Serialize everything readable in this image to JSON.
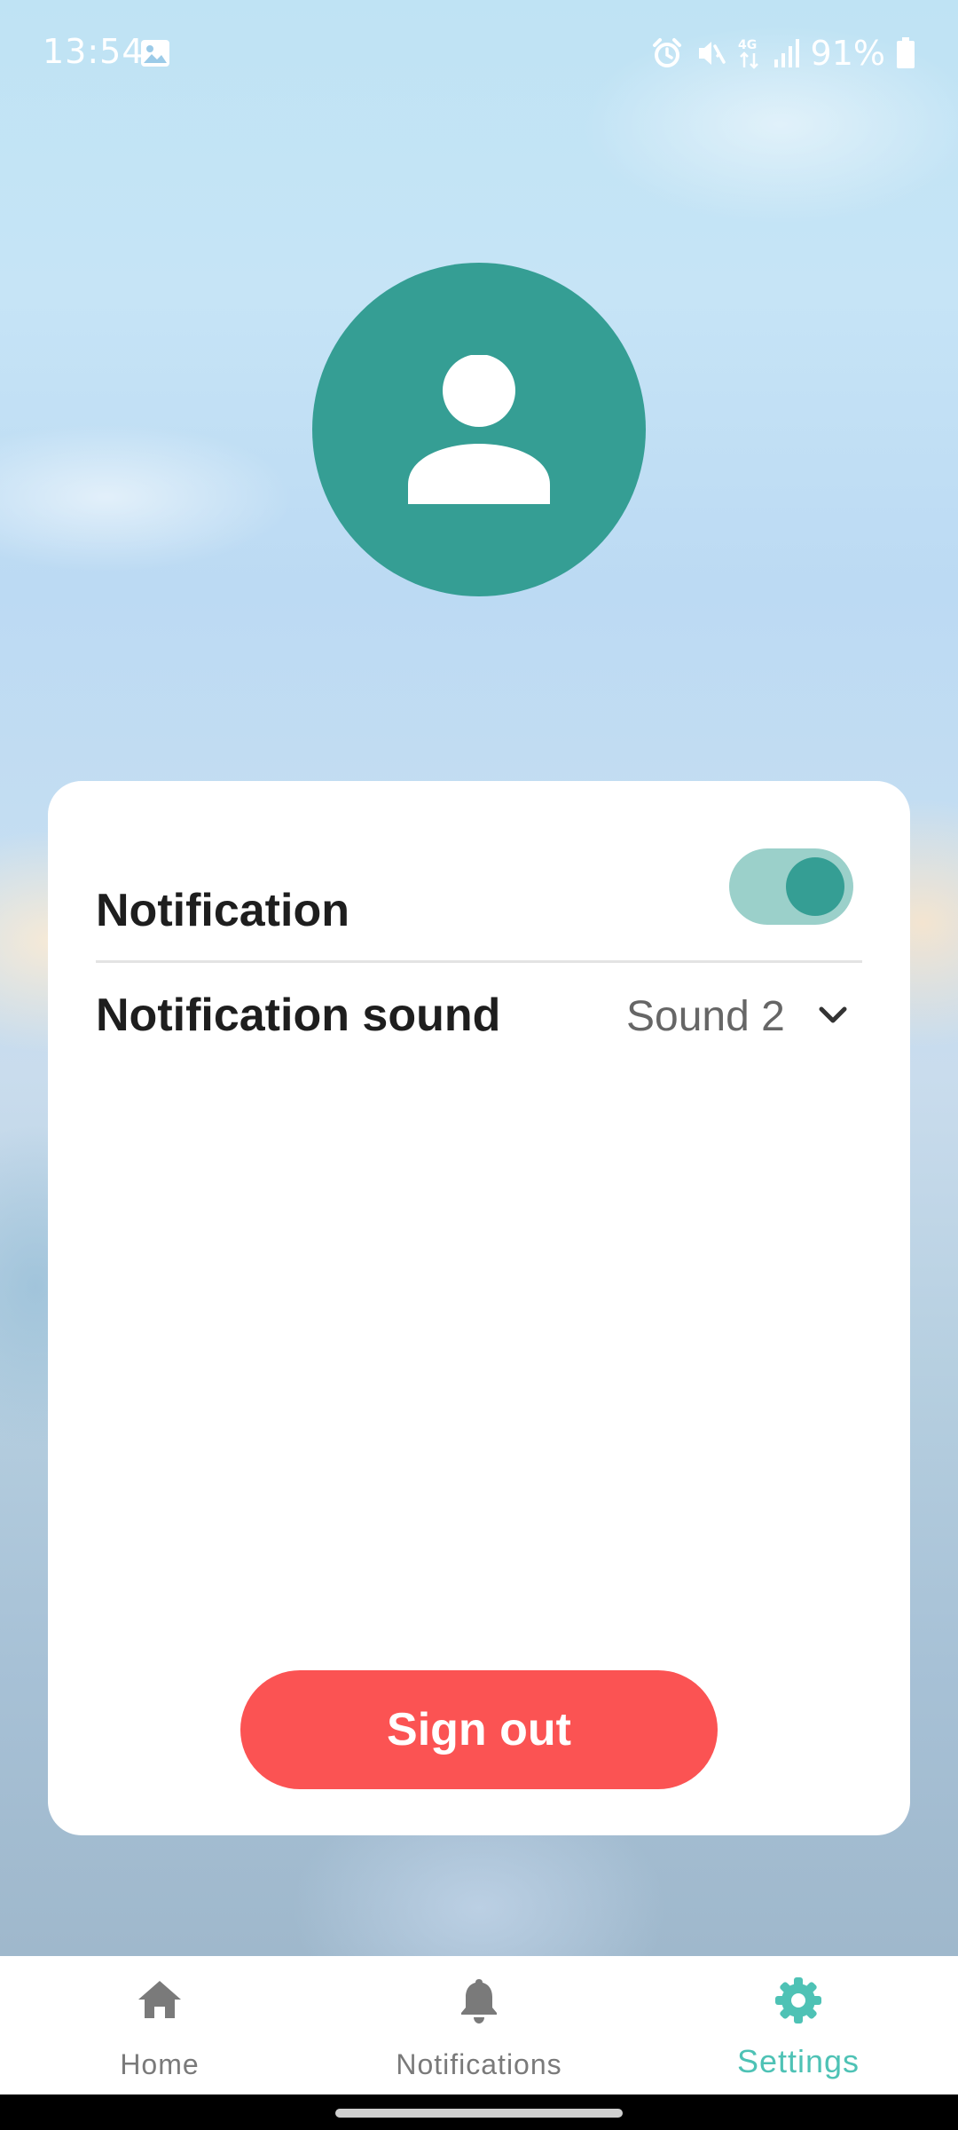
{
  "status_bar": {
    "time": "13:54",
    "battery_percent": "91%",
    "network_type": "4G",
    "icons": [
      "gallery-icon",
      "alarm-icon",
      "vibrate-off-icon",
      "network-4g-icon",
      "signal-icon",
      "battery-icon"
    ]
  },
  "profile": {
    "avatar_icon": "person-icon",
    "avatar_color": "#359e94"
  },
  "settings": {
    "notification_label": "Notification",
    "notification_enabled": true,
    "sound_label": "Notification sound",
    "sound_value": "Sound 2",
    "sound_icon": "chevron-down-icon",
    "accent_color": "#359e94"
  },
  "actions": {
    "sign_out_label": "Sign out",
    "sign_out_color": "#fb5353"
  },
  "bottom_nav": {
    "items": [
      {
        "label": "Home",
        "icon": "home-icon",
        "active": false
      },
      {
        "label": "Notifications",
        "icon": "bell-icon",
        "active": false
      },
      {
        "label": "Settings",
        "icon": "gear-icon",
        "active": true
      }
    ],
    "active_color": "#4ec2b5",
    "inactive_color": "#7a7a7a"
  }
}
